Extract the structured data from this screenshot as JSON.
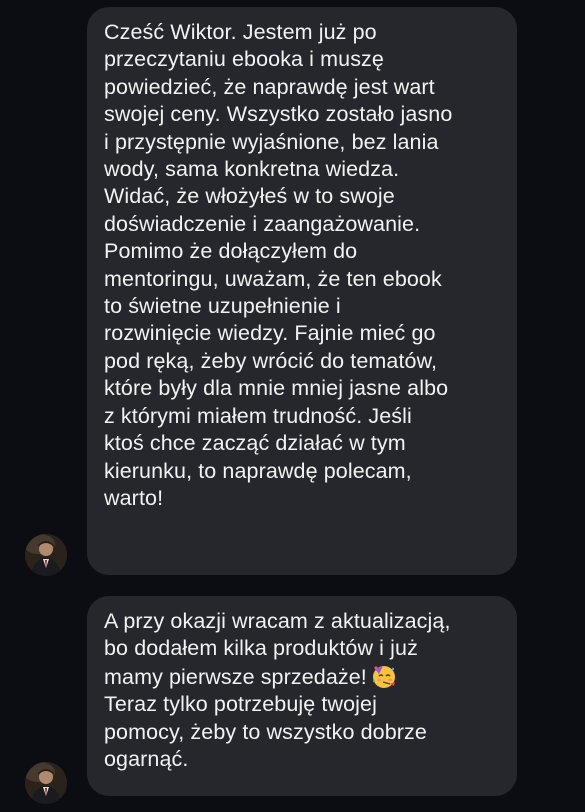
{
  "messages": [
    {
      "lines": [
        "Cześć Wiktor. Jestem już po",
        "przeczytaniu ebooka i muszę",
        "powiedzieć, że naprawdę jest wart",
        "swojej ceny. Wszystko zostało jasno",
        "i przystępnie wyjaśnione, bez lania",
        "wody, sama konkretna wiedza.",
        "Widać, że włożyłeś w to swoje",
        "doświadczenie i zaangażowanie.",
        "Pomimo że dołączyłem do",
        "mentoringu, uważam, że ten ebook",
        "to świetne uzupełnienie i",
        "rozwinięcie wiedzy. Fajnie mieć go",
        "pod ręką, żeby wrócić do tematów,",
        "które były dla mnie mniej jasne albo",
        "z którymi miałem trudność. Jeśli",
        "ktoś chce zacząć działać w tym",
        "kierunku, to naprawdę polecam,",
        "warto!"
      ]
    },
    {
      "lines": [
        "A przy okazji wracam z aktualizacją,",
        "bo dodałem kilka produktów i już",
        "mamy pierwsze sprzedaże!",
        "Teraz tylko potrzebuję twojej",
        "pomocy, żeby to wszystko dobrze",
        "ogarnąć."
      ],
      "emoji": "partying-face-emoji"
    }
  ],
  "colors": {
    "background": "#0c0d12",
    "bubble": "#26272c",
    "text": "#f2f2f2"
  },
  "icons": {
    "avatar": "sender-avatar"
  }
}
